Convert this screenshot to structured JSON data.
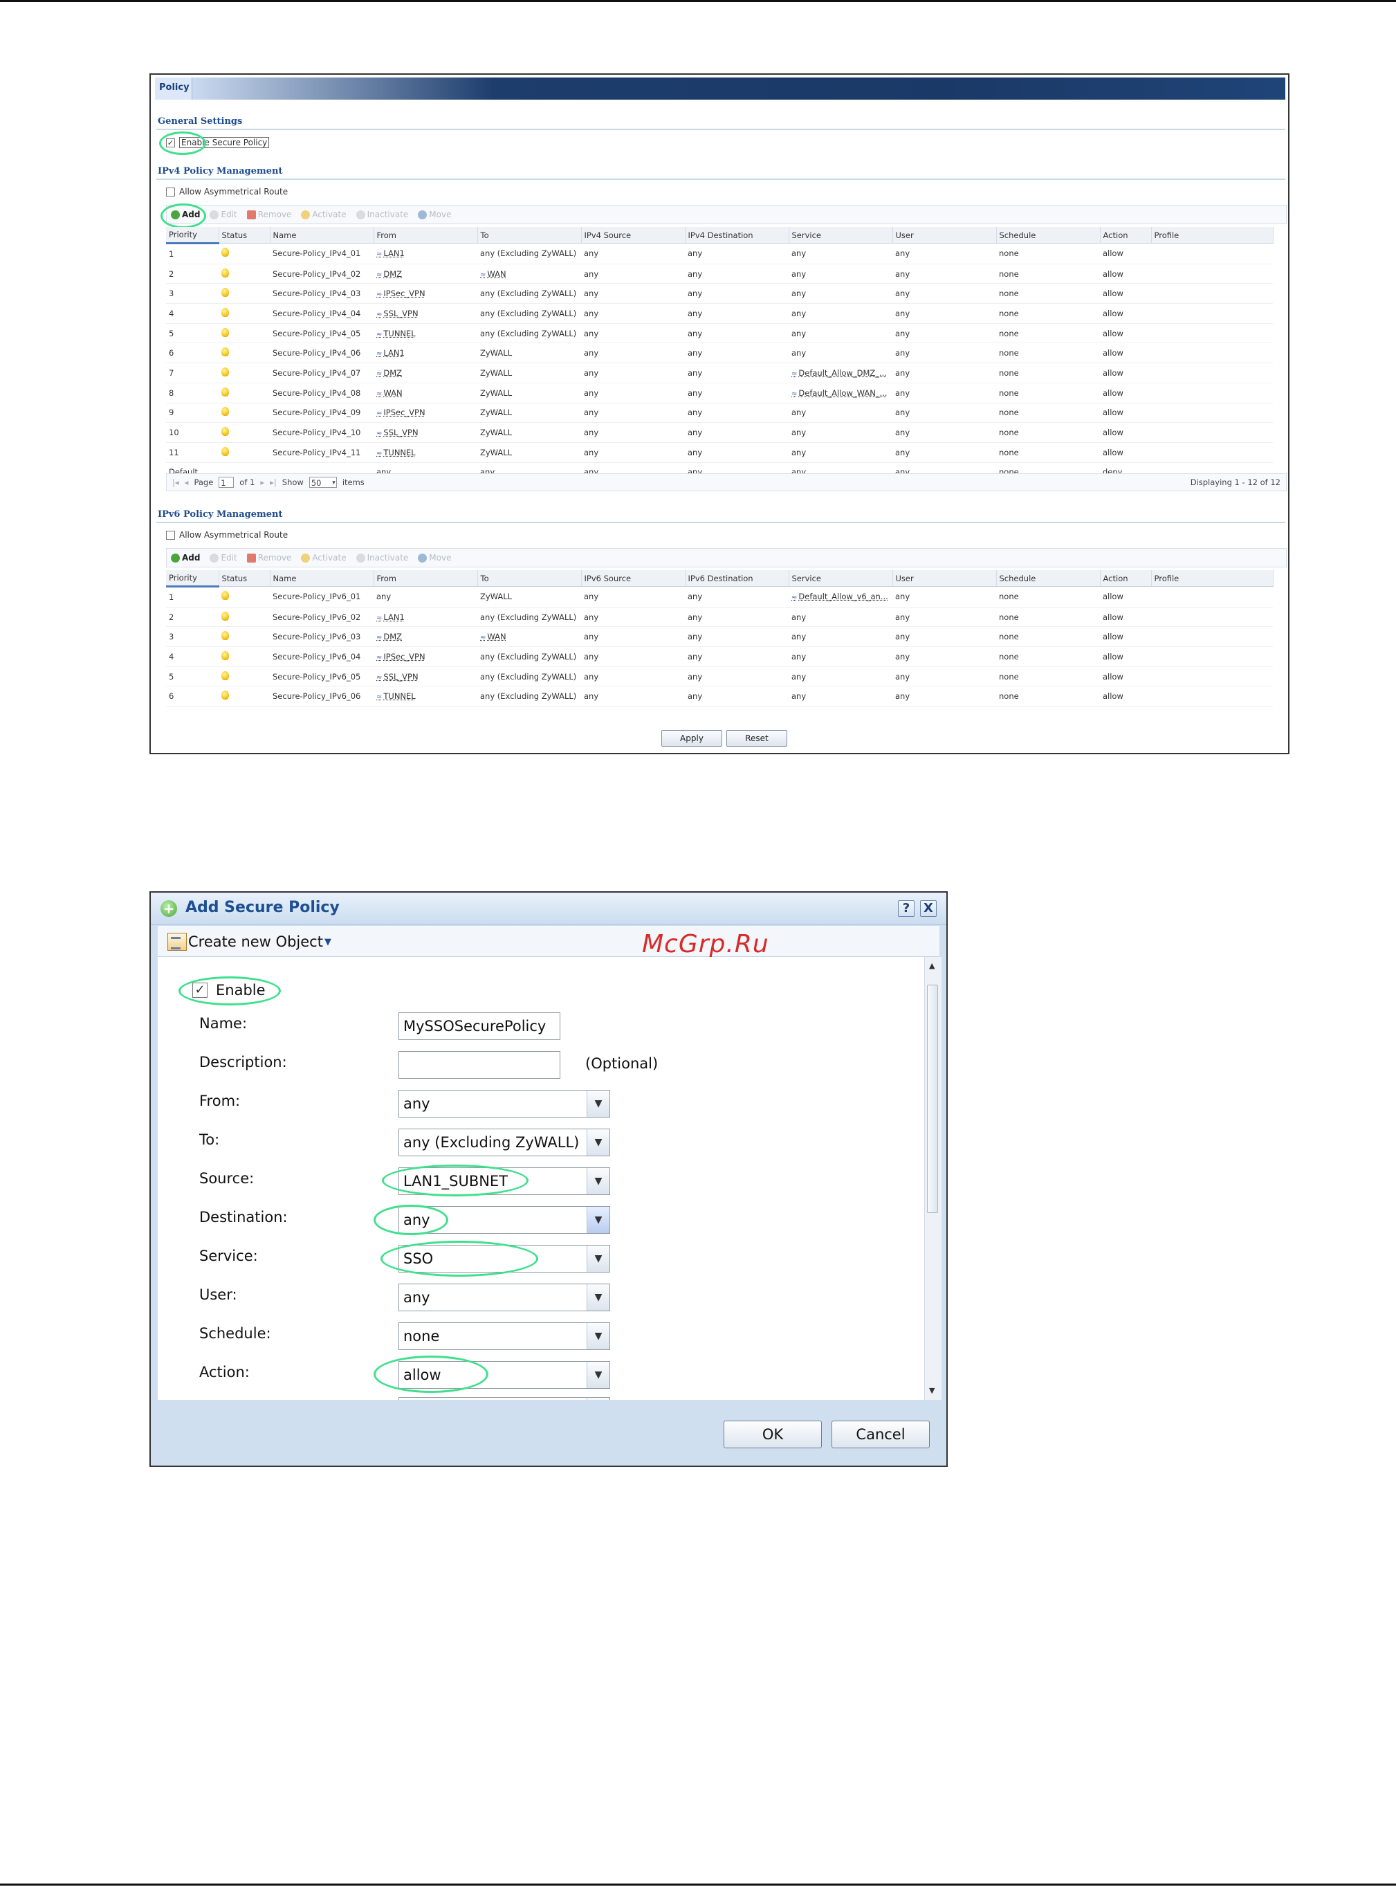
{
  "policy": {
    "title": "Policy",
    "general_settings": {
      "heading": "General Settings",
      "enable_label": "Enable Secure Policy",
      "enabled": true
    },
    "ipv4": {
      "heading": "IPv4 Policy Management",
      "asym_label": "Allow Asymmetrical Route",
      "toolbar": [
        "Add",
        "Edit",
        "Remove",
        "Activate",
        "Inactivate",
        "Move"
      ],
      "columns": [
        "Priority",
        "Status",
        "Name",
        "From",
        "To",
        "IPv4 Source",
        "IPv4 Destination",
        "Service",
        "User",
        "Schedule",
        "Action",
        "Profile"
      ],
      "rows": [
        [
          "1",
          "",
          "Secure-Policy_IPv4_01",
          "LAN1",
          "any (Excluding ZyWALL)",
          "any",
          "any",
          "any",
          "any",
          "none",
          "allow",
          ""
        ],
        [
          "2",
          "",
          "Secure-Policy_IPv4_02",
          "DMZ",
          "WAN",
          "any",
          "any",
          "any",
          "any",
          "none",
          "allow",
          ""
        ],
        [
          "3",
          "",
          "Secure-Policy_IPv4_03",
          "IPSec_VPN",
          "any (Excluding ZyWALL)",
          "any",
          "any",
          "any",
          "any",
          "none",
          "allow",
          ""
        ],
        [
          "4",
          "",
          "Secure-Policy_IPv4_04",
          "SSL_VPN",
          "any (Excluding ZyWALL)",
          "any",
          "any",
          "any",
          "any",
          "none",
          "allow",
          ""
        ],
        [
          "5",
          "",
          "Secure-Policy_IPv4_05",
          "TUNNEL",
          "any (Excluding ZyWALL)",
          "any",
          "any",
          "any",
          "any",
          "none",
          "allow",
          ""
        ],
        [
          "6",
          "",
          "Secure-Policy_IPv4_06",
          "LAN1",
          "ZyWALL",
          "any",
          "any",
          "any",
          "any",
          "none",
          "allow",
          ""
        ],
        [
          "7",
          "",
          "Secure-Policy_IPv4_07",
          "DMZ",
          "ZyWALL",
          "any",
          "any",
          "Default_Allow_DMZ_...",
          "any",
          "none",
          "allow",
          ""
        ],
        [
          "8",
          "",
          "Secure-Policy_IPv4_08",
          "WAN",
          "ZyWALL",
          "any",
          "any",
          "Default_Allow_WAN_...",
          "any",
          "none",
          "allow",
          ""
        ],
        [
          "9",
          "",
          "Secure-Policy_IPv4_09",
          "IPSec_VPN",
          "ZyWALL",
          "any",
          "any",
          "any",
          "any",
          "none",
          "allow",
          ""
        ],
        [
          "10",
          "",
          "Secure-Policy_IPv4_10",
          "SSL_VPN",
          "ZyWALL",
          "any",
          "any",
          "any",
          "any",
          "none",
          "allow",
          ""
        ],
        [
          "11",
          "",
          "Secure-Policy_IPv4_11",
          "TUNNEL",
          "ZyWALL",
          "any",
          "any",
          "any",
          "any",
          "none",
          "allow",
          ""
        ],
        [
          "Default",
          "",
          "",
          "any",
          "any",
          "any",
          "any",
          "any",
          "any",
          "none",
          "deny",
          ""
        ]
      ],
      "pager": {
        "page_label": "Page",
        "page": "1",
        "of_label": "of 1",
        "show_label": "Show",
        "show": "50",
        "items_label": "items",
        "displaying": "Displaying 1 - 12 of 12"
      }
    },
    "ipv6": {
      "heading": "IPv6 Policy Management",
      "asym_label": "Allow Asymmetrical Route",
      "toolbar": [
        "Add",
        "Edit",
        "Remove",
        "Activate",
        "Inactivate",
        "Move"
      ],
      "columns": [
        "Priority",
        "Status",
        "Name",
        "From",
        "To",
        "IPv6 Source",
        "IPv6 Destination",
        "Service",
        "User",
        "Schedule",
        "Action",
        "Profile"
      ],
      "rows": [
        [
          "1",
          "",
          "Secure-Policy_IPv6_01",
          "any",
          "ZyWALL",
          "any",
          "any",
          "Default_Allow_v6_an...",
          "any",
          "none",
          "allow",
          ""
        ],
        [
          "2",
          "",
          "Secure-Policy_IPv6_02",
          "LAN1",
          "any (Excluding ZyWALL)",
          "any",
          "any",
          "any",
          "any",
          "none",
          "allow",
          ""
        ],
        [
          "3",
          "",
          "Secure-Policy_IPv6_03",
          "DMZ",
          "WAN",
          "any",
          "any",
          "any",
          "any",
          "none",
          "allow",
          ""
        ],
        [
          "4",
          "",
          "Secure-Policy_IPv6_04",
          "IPSec_VPN",
          "any (Excluding ZyWALL)",
          "any",
          "any",
          "any",
          "any",
          "none",
          "allow",
          ""
        ],
        [
          "5",
          "",
          "Secure-Policy_IPv6_05",
          "SSL_VPN",
          "any (Excluding ZyWALL)",
          "any",
          "any",
          "any",
          "any",
          "none",
          "allow",
          ""
        ],
        [
          "6",
          "",
          "Secure-Policy_IPv6_06",
          "TUNNEL",
          "any (Excluding ZyWALL)",
          "any",
          "any",
          "any",
          "any",
          "none",
          "allow",
          ""
        ]
      ]
    },
    "apply_label": "Apply",
    "reset_label": "Reset"
  },
  "dialog": {
    "title": "Add Secure Policy",
    "help_label": "?",
    "close_label": "X",
    "create_new_object": "Create new Object",
    "watermark": "McGrp.Ru",
    "enable_label": "Enable",
    "fields": {
      "name": {
        "label": "Name:",
        "value": "MySSOSecurePolicy"
      },
      "description": {
        "label": "Description:",
        "value": "",
        "hint": "(Optional)"
      },
      "from": {
        "label": "From:",
        "value": "any"
      },
      "to": {
        "label": "To:",
        "value": "any (Excluding ZyWALL)"
      },
      "source": {
        "label": "Source:",
        "value": "LAN1_SUBNET"
      },
      "destination": {
        "label": "Destination:",
        "value": "any"
      },
      "service": {
        "label": "Service:",
        "value": "SSO"
      },
      "user": {
        "label": "User:",
        "value": "any"
      },
      "schedule": {
        "label": "Schedule:",
        "value": "none"
      },
      "action": {
        "label": "Action:",
        "value": "allow"
      }
    },
    "ok_label": "OK",
    "cancel_label": "Cancel"
  },
  "colors": {
    "highlight_ellipse": "#3fe08c",
    "title_bar": "#1b3967",
    "accent": "#1f4d8f"
  }
}
